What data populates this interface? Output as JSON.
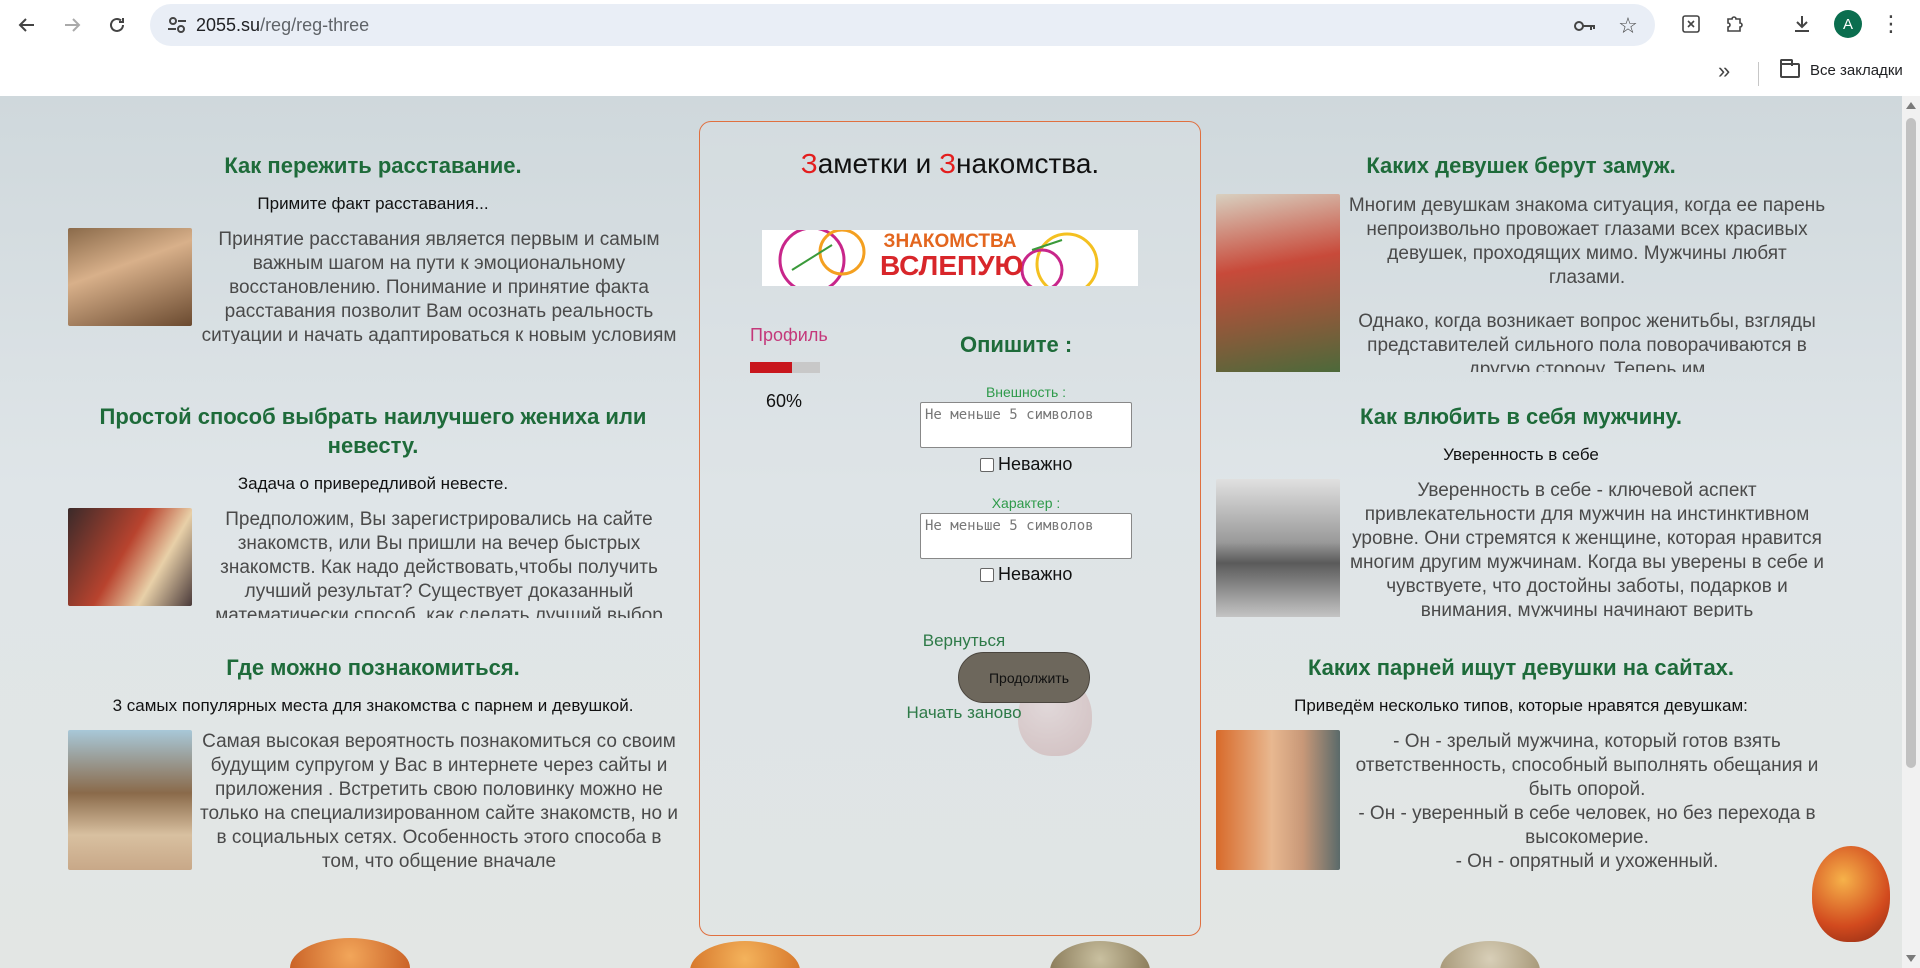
{
  "browser": {
    "url_host": "2055.su",
    "url_path": "/reg/reg-three",
    "avatar_letter": "A",
    "bookmarks_folder": "Все закладки"
  },
  "card": {
    "title_letter_1": "З",
    "title_part_1": "аметки и ",
    "title_letter_2": "З",
    "title_part_2": "накомства.",
    "banner_text_1": "ЗНАКОМСТВА",
    "banner_text_2": "ВСЛЕПУЮ",
    "profile_label": "Профиль",
    "progress_percent": 60,
    "progress_text": "60%",
    "describe_heading": "Опишите :",
    "appearance_label": "Внешность :",
    "appearance_placeholder": "Не меньше 5 символов",
    "appearance_checkbox": "Неважно",
    "character_label": "Характер :",
    "character_placeholder": "Не меньше 5 символов",
    "character_checkbox": "Неважно",
    "back_label": "Вернуться",
    "continue_label": "Продолжить",
    "restart_label": "Начать заново"
  },
  "left_articles": [
    {
      "title": "Как пережить расставание.",
      "lead": "Примите факт расставания...",
      "text": "Принятие расставания является первым и самым важным шагом на пути к эмоциональному восстановлению. Понимание и принятие факта расставания позволит Вам осознать реальность ситуации и начать адаптироваться к новым условиям жизни. Отношения закончились, и больше нет смысла"
    },
    {
      "title": "Простой способ выбрать наилучшего жениха или невесту.",
      "lead": "Задача о привередливой невесте.",
      "text": "Предположим, Вы зарегистрировались на сайте знакомств, или Вы пришли на вечер быстрых знакомств. Как надо действовать,чтобы получить лучший результат? Существует доказанный математически способ, как сделать лучший выбор"
    },
    {
      "title": "Где можно познакомиться.",
      "lead": "3 самых популярных места для знакомства с парнем и девушкой.",
      "text": "Самая высокая вероятность познакомиться со своим будущим супругом у Вас в интернете через сайты и приложения . Встретить свою половинку можно не только на специализированном сайте знакомств, но и в социальных сетях. Особенность этого способа в том, что общение вначале"
    }
  ],
  "right_articles": [
    {
      "title": "Каких девушек берут замуж.",
      "text_1": "Многим девушкам знакома ситуация, когда ее парень непроизвольно провожает глазами всех красивых девушек, проходящих мимо. Мужчины любят глазами.",
      "text_2": "Однако, когда возникает вопрос женитьбы, взгляды представителей сильного пола поворачиваются в другую сторону. Теперь им"
    },
    {
      "title": "Как влюбить в себя мужчину.",
      "lead": "Уверенность в себе",
      "text": "Уверенность в себе - ключевой аспект привлекательности для мужчин на инстинктивном уровне. Они стремятся к женщине, которая нравится многим другим мужчинам. Когда вы уверены в себе и чувствуете, что достойны заботы, подарков и внимания, мужчины начинают верить"
    },
    {
      "title": "Каких парней ищут девушки на сайтах.",
      "lead": "Приведём несколько типов, которые нравятся девушкам:",
      "line_1": "- Он - зрелый мужчина, который готов взять ответственность, способный выполнять обещания и быть опорой.",
      "line_2": "- Он - уверенный в себе человек, но без перехода в высокомерие.",
      "line_3": "- Он - опрятный и ухоженный."
    }
  ],
  "colors": {
    "heading_green": "#1e6b3a",
    "accent_red": "#e31e1e",
    "card_border": "#e07040",
    "progress_fill": "#c8161d"
  }
}
